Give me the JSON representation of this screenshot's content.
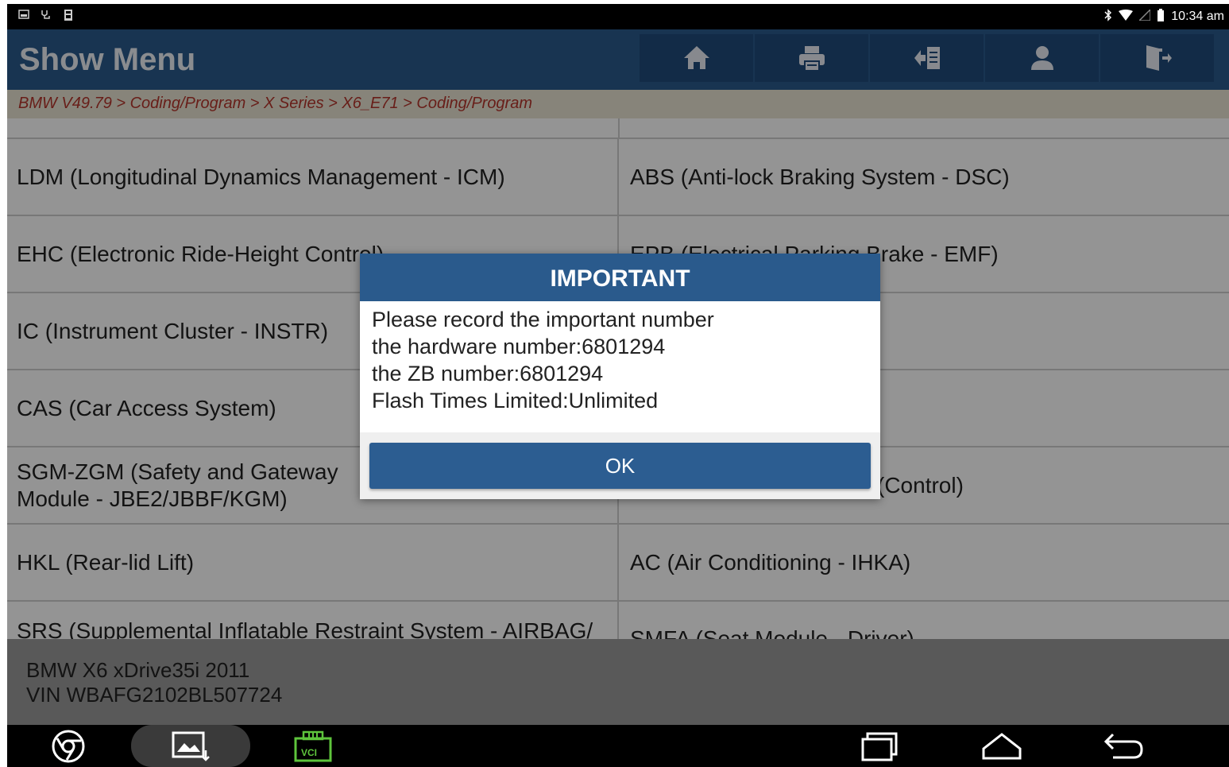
{
  "status_bar": {
    "time": "10:34 am"
  },
  "header": {
    "title": "Show Menu"
  },
  "toolbar": {
    "buttons": [
      {
        "icon": "home-icon"
      },
      {
        "icon": "print-icon"
      },
      {
        "icon": "report-icon"
      },
      {
        "icon": "user-icon"
      },
      {
        "icon": "exit-icon"
      }
    ]
  },
  "breadcrumb": "BMW V49.79 > Coding/Program > X Series > X6_E71 > Coding/Program",
  "menu": {
    "left": [
      "LDM (Longitudinal Dynamics Management - ICM)",
      "EHC (Electronic Ride-Height Control)",
      "IC (Instrument Cluster - INSTR)",
      "CAS (Car Access System)",
      "SGM-ZGM (Safety and Gateway Module - JBE2/JBBF/KGM)",
      "HKL (Rear-lid Lift)",
      "SRS (Supplemental Inflatable Restraint System - AIRBAG/"
    ],
    "right": [
      "ABS (Anti-lock Braking System - DSC)",
      "EPB (Electrical Parking Brake - EMF)",
      "",
      "",
      "(Control)",
      "AC (Air Conditioning - IHKA)",
      "SMFA (Seat Module - Driver)"
    ]
  },
  "vehicle": {
    "model": "BMW X6 xDrive35i 2011",
    "vin": "VIN WBAFG2102BL507724"
  },
  "dialog": {
    "title": "IMPORTANT",
    "lines": [
      "Please record the important number",
      "the hardware number:6801294",
      "the ZB number:6801294",
      "Flash Times Limited:Unlimited"
    ],
    "ok_label": "OK"
  },
  "nav": {
    "vci_label": "VCI"
  },
  "colors": {
    "header_blue": "#2a5a8c",
    "breadcrumb_red": "#b3352b",
    "vci_green": "#5ec43c"
  }
}
